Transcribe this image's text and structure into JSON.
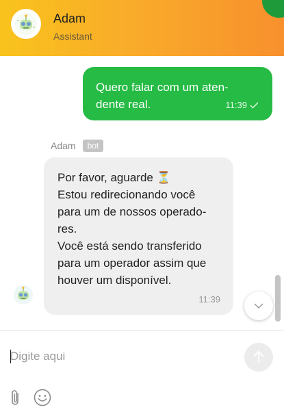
{
  "header": {
    "title": "Adam",
    "subtitle": "Assistant",
    "avatar_icon": "robot-face-icon",
    "gradient": [
      "#f9c31c",
      "#f8902d"
    ]
  },
  "messages": {
    "outgoing": {
      "lines": [
        "Quero falar com um aten-",
        "dente real."
      ],
      "time": "11:39",
      "status_icon": "check-icon",
      "color": "#25bb44"
    },
    "incoming": {
      "sender": "Adam",
      "tag": "bot",
      "lines": [
        "Por favor, aguarde ⏳",
        "Estou redirecionando você",
        "para um de nossos operado-",
        "res.",
        "Você está sendo transferido",
        "para um operador assim que",
        "houver um disponível."
      ],
      "time": "11:39",
      "color": "#efefef"
    }
  },
  "composer": {
    "placeholder": "Digite aqui",
    "value": "",
    "send_icon": "arrow-up-icon",
    "attach_icon": "paperclip-icon",
    "emoji_icon": "smiley-icon"
  },
  "scroll_button_icon": "chevron-down-icon"
}
